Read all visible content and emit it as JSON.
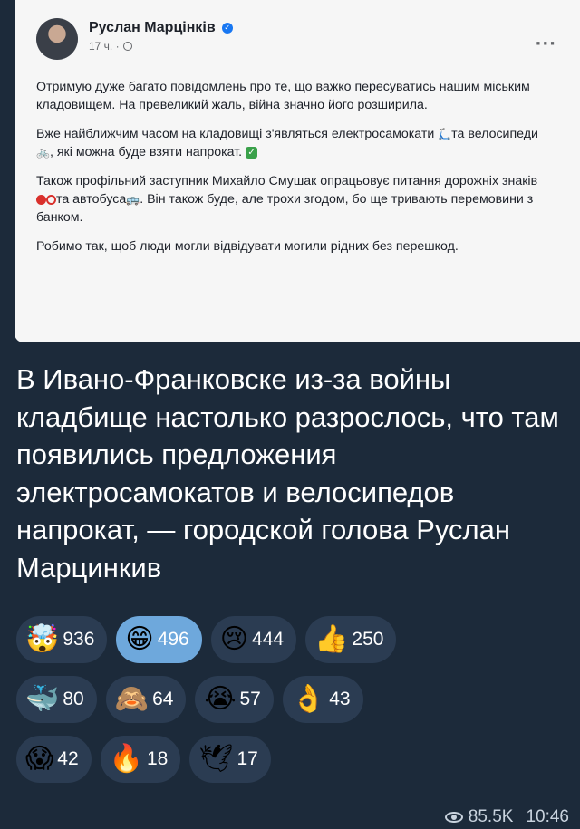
{
  "fb_post": {
    "author": "Руслан Марцінків",
    "time": "17 ч. ·",
    "more": "···",
    "paragraphs": [
      "Отримую дуже багато повідомлень про те, що важко пересуватись нашим міським кладовищем. На превеликий жаль, війна значно його розширила.",
      "Вже найближчим часом на кладовищі з'являться електросамокати",
      "та велосипеди",
      ", які можна буде взяти напрокат.",
      "Також профільний заступник Михайло Смушак опрацьовує питання дорожніх знаків",
      "та автобуса",
      ". Він також буде, але трохи згодом, бо ще тривають перемовини з банком.",
      "Робимо так, щоб люди могли відвідувати могили рідних без перешкод."
    ]
  },
  "message": {
    "text": "В Ивано-Франковске из-за войны кладбище настолько разрослось, что там появились предложения электросамокатов и велосипедов напрокат, — городской голова Руслан Марцинкив"
  },
  "reactions": [
    {
      "emoji": "🤯",
      "count": "936",
      "active": false
    },
    {
      "emoji": "😁",
      "count": "496",
      "active": true
    },
    {
      "emoji": "😢",
      "count": "444",
      "active": false
    },
    {
      "emoji": "👍",
      "count": "250",
      "active": false
    },
    {
      "emoji": "🐳",
      "count": "80",
      "active": false
    },
    {
      "emoji": "🙈",
      "count": "64",
      "active": false
    },
    {
      "emoji": "😭",
      "count": "57",
      "active": false
    },
    {
      "emoji": "👌",
      "count": "43",
      "active": false
    },
    {
      "emoji": "😱",
      "count": "42",
      "active": false
    },
    {
      "emoji": "🔥",
      "count": "18",
      "active": false
    },
    {
      "emoji": "🕊",
      "count": "17",
      "active": false
    }
  ],
  "footer": {
    "views": "85.5K",
    "time": "10:46"
  }
}
